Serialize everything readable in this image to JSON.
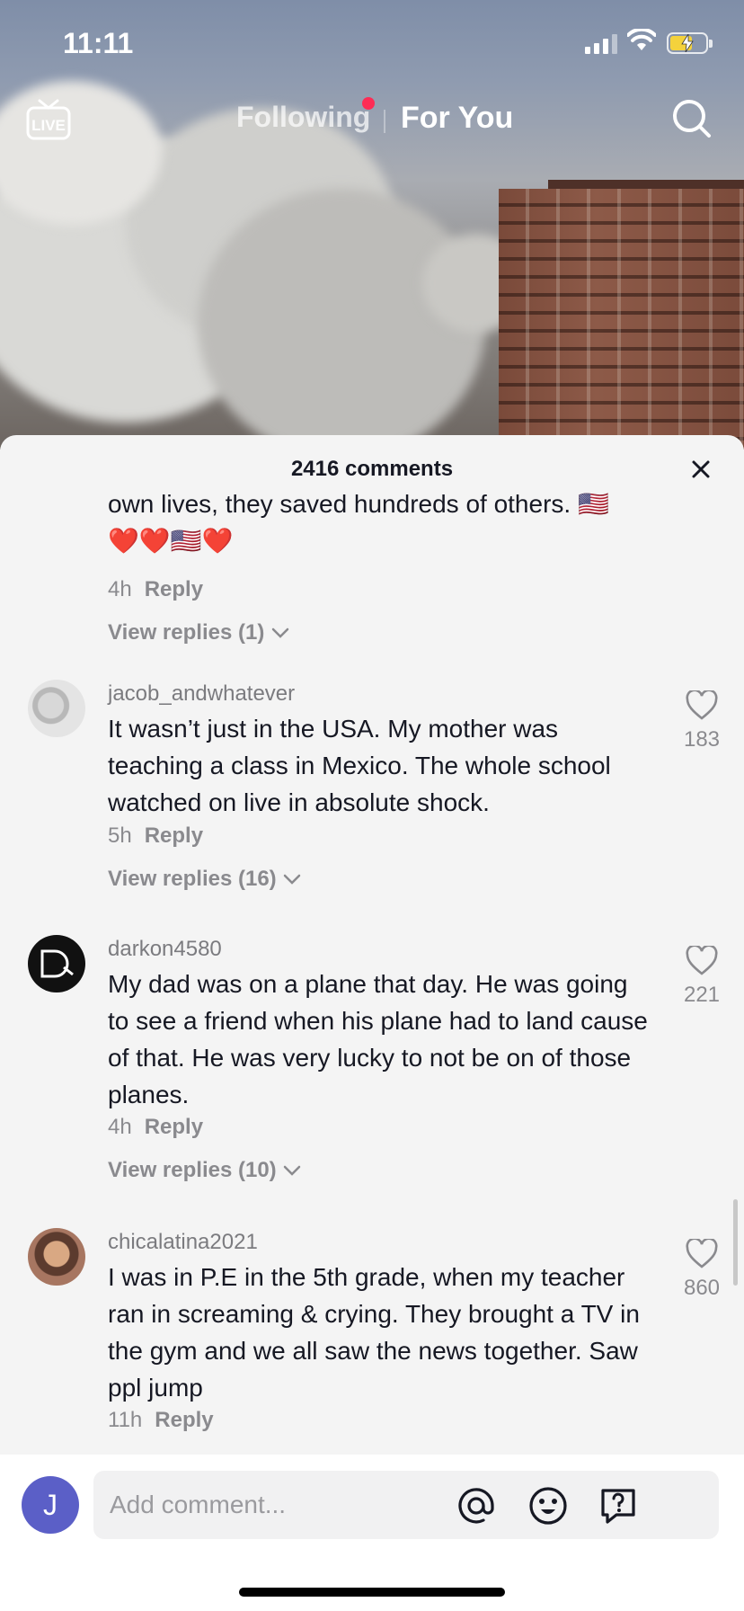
{
  "status_bar": {
    "time": "11:11"
  },
  "top_nav": {
    "following": "Following",
    "for_you": "For You",
    "live": "LIVE"
  },
  "comments_sheet": {
    "title": "2416 comments",
    "partial_comment": {
      "text": "own lives, they saved hundreds of others. 🇺🇸",
      "text2": "❤️❤️🇺🇸❤️",
      "time": "4h",
      "reply": "Reply",
      "view_replies": "View replies (1)"
    },
    "comments": [
      {
        "username": "jacob_andwhatever",
        "text": "It wasn’t just in the USA. My mother was teaching a class in Mexico. The whole school watched on live in absolute shock.",
        "time": "5h",
        "reply": "Reply",
        "likes": "183",
        "view_replies": "View replies (16)"
      },
      {
        "username": "darkon4580",
        "text": "My dad was on a plane that day. He was going to see a friend when his plane had to land cause of that. He was very lucky to not be on of those planes.",
        "time": "4h",
        "reply": "Reply",
        "likes": "221",
        "view_replies": "View replies (10)"
      },
      {
        "username": "chicalatina2021",
        "text": "I was in P.E in the 5th grade, when my teacher ran in screaming & crying. They brought a TV in the gym and we all saw the news together. Saw ppl jump",
        "time": "11h",
        "reply": "Reply",
        "likes": "860"
      }
    ]
  },
  "composer": {
    "avatar_letter": "J",
    "placeholder": "Add comment...",
    "icons": [
      "mention-icon",
      "emoji-icon",
      "question-icon"
    ]
  },
  "colors": {
    "accent": "#fe2c55",
    "avatar_bg": "#5b5fc7"
  }
}
